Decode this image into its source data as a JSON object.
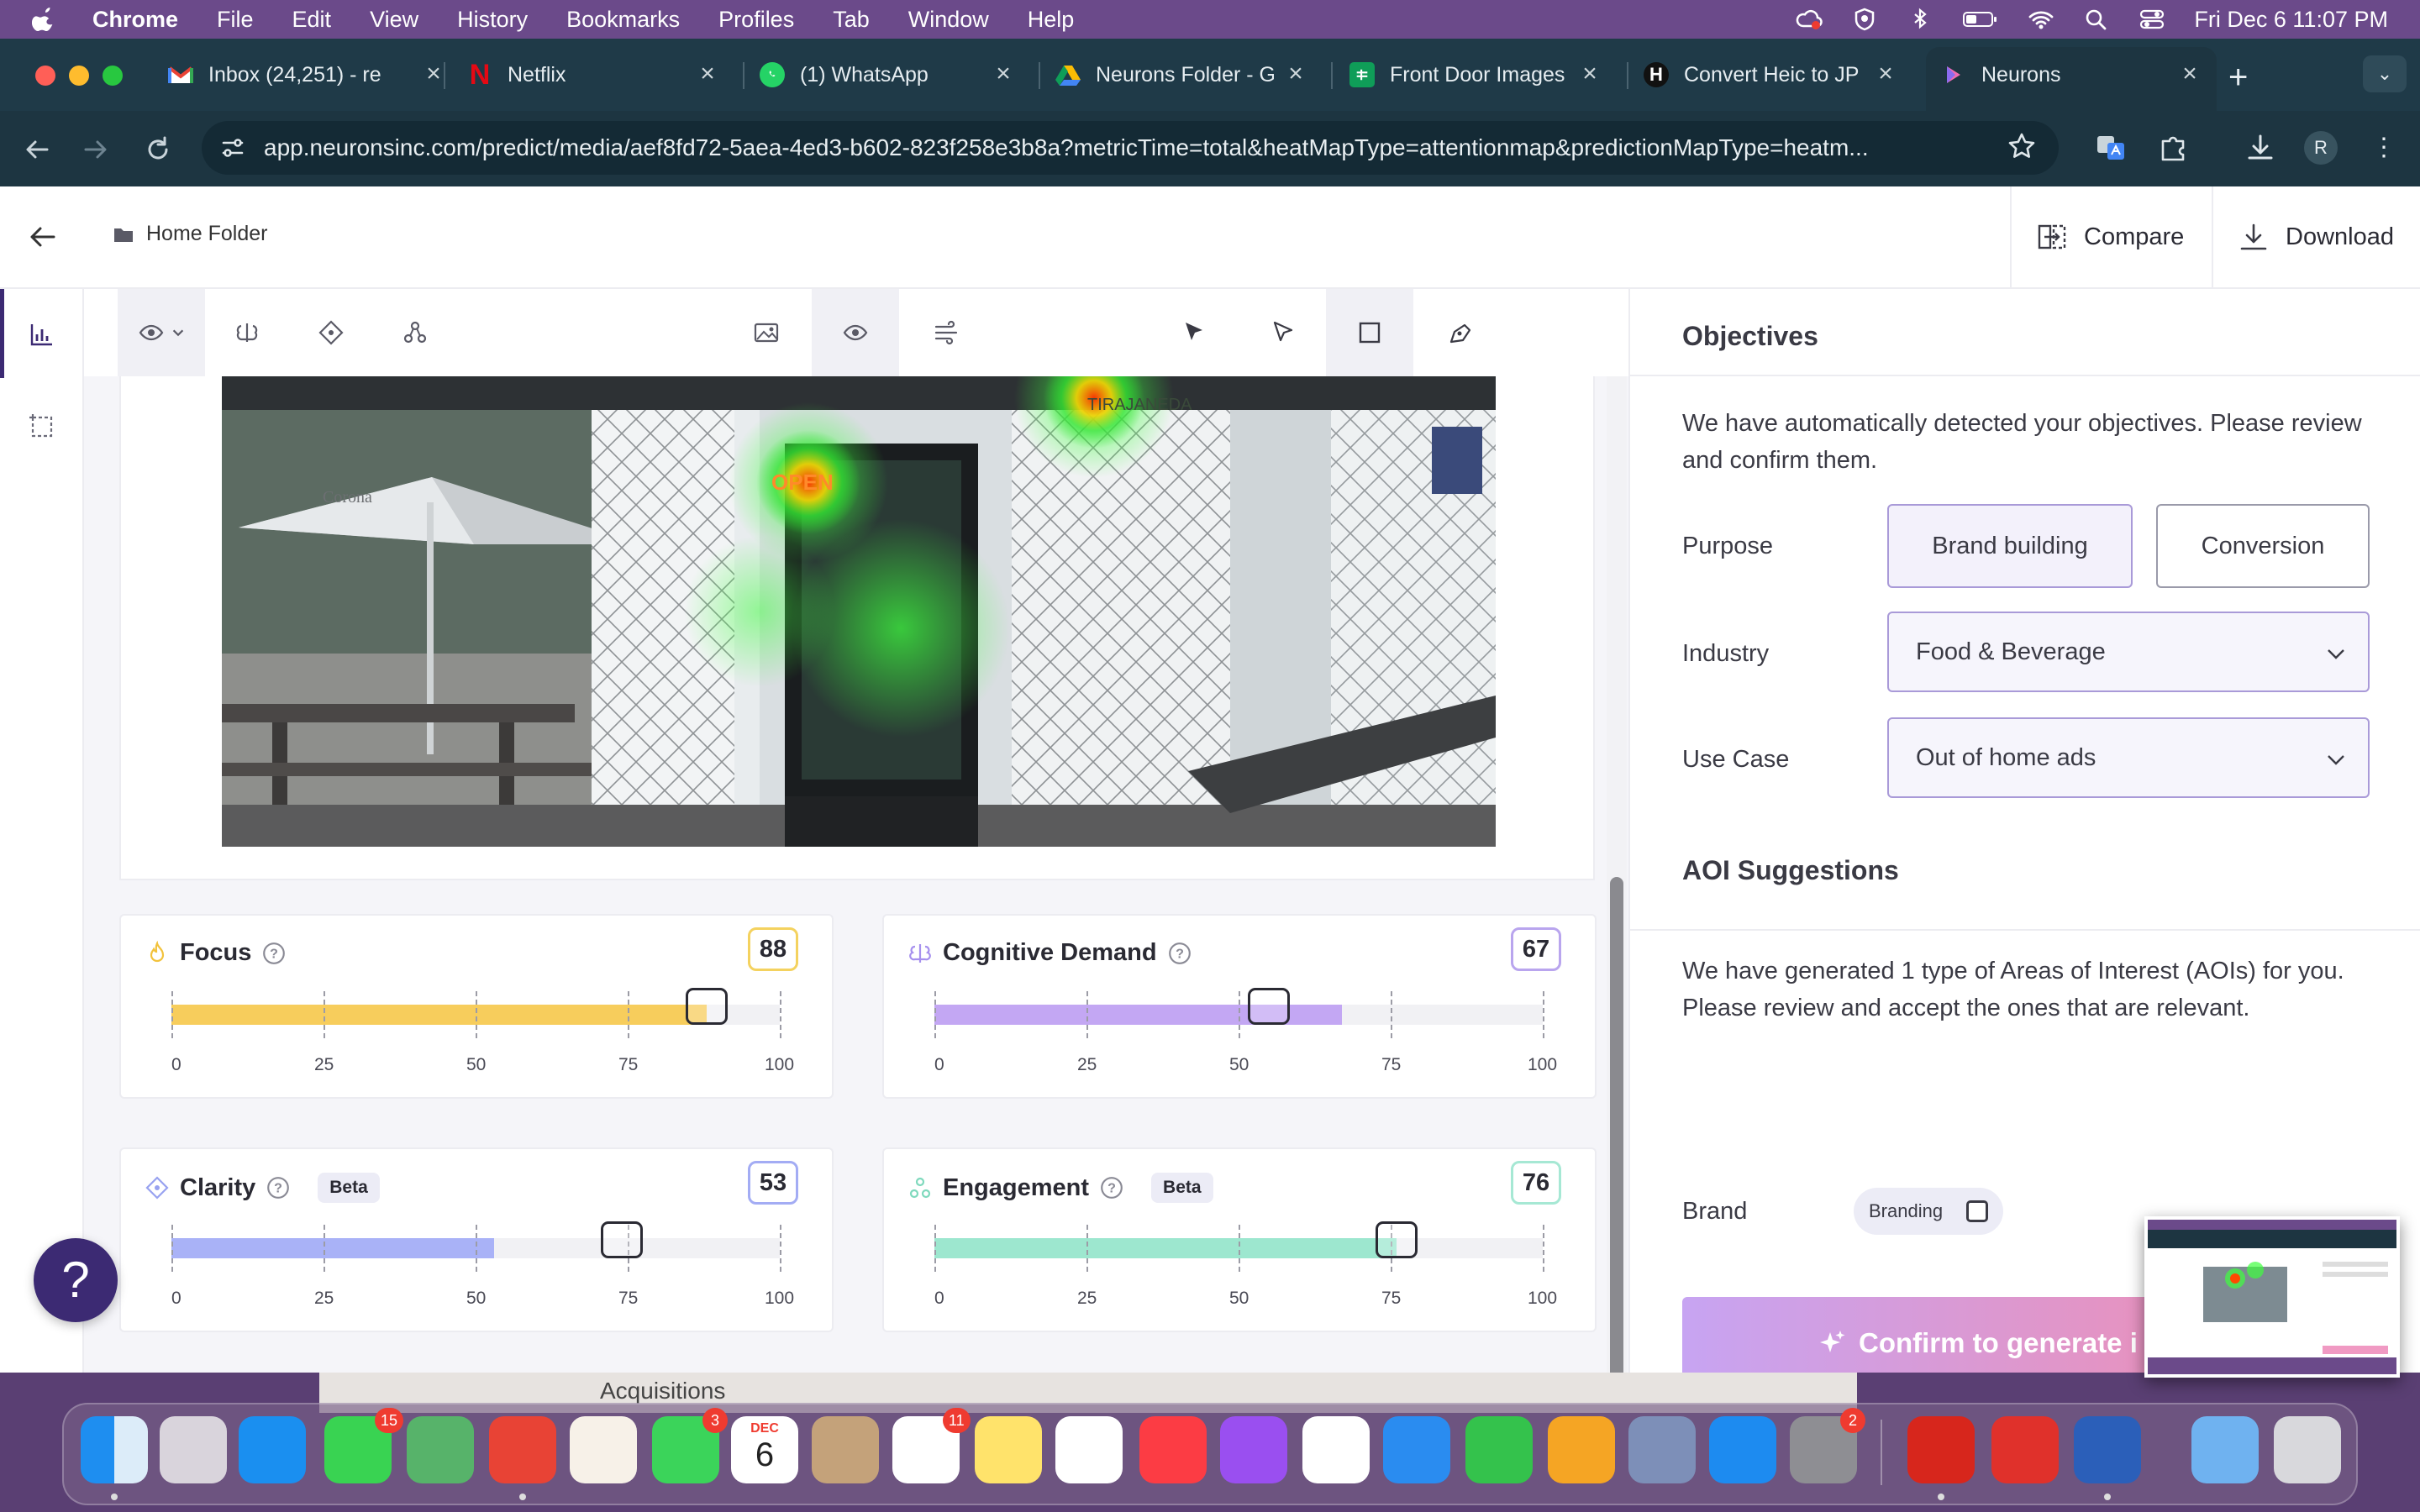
{
  "menubar": {
    "app": "Chrome",
    "items": [
      "File",
      "Edit",
      "View",
      "History",
      "Bookmarks",
      "Profiles",
      "Tab",
      "Window",
      "Help"
    ],
    "clock": "Fri Dec 6  11:07 PM"
  },
  "tabs": [
    {
      "title": "Inbox (24,251) - re",
      "icon": "gmail-icon"
    },
    {
      "title": "Netflix",
      "icon": "netflix-icon"
    },
    {
      "title": "(1) WhatsApp",
      "icon": "whatsapp-icon"
    },
    {
      "title": "Neurons Folder - G",
      "icon": "google-drive-icon"
    },
    {
      "title": "Front Door Images",
      "icon": "google-sheets-icon"
    },
    {
      "title": "Convert Heic to JP",
      "icon": "h-icon"
    },
    {
      "title": "Neurons",
      "icon": "neurons-icon",
      "active": true
    }
  ],
  "address_bar": {
    "url": "app.neuronsinc.com/predict/media/aef8fd72-5aea-4ed3-b602-823f258e3b8a?metricTime=total&heatMapType=attentionmap&predictionMapType=heatm..."
  },
  "profile_initial": "R",
  "app_header": {
    "breadcrumb": "Home Folder",
    "compare_label": "Compare",
    "download_label": "Download"
  },
  "metrics": [
    {
      "name": "Focus",
      "score": "88",
      "value": 88,
      "handle": 88,
      "color": "#f7cd5c",
      "border": "#f4d25f",
      "beta": false
    },
    {
      "name": "Cognitive Demand",
      "score": "67",
      "value": 67,
      "handle": 55,
      "color": "#c3a7f3",
      "border": "#b9a5ee",
      "beta": false
    },
    {
      "name": "Clarity",
      "score": "53",
      "value": 53,
      "handle": 74,
      "color": "#a9b2f7",
      "border": "#a3acf4",
      "beta": true
    },
    {
      "name": "Engagement",
      "score": "76",
      "value": 76,
      "handle": 76,
      "color": "#9de7cf",
      "border": "#a6e8d4",
      "beta": true
    }
  ],
  "axis_ticks": [
    "0",
    "25",
    "50",
    "75",
    "100"
  ],
  "beta_label": "Beta",
  "objectives": {
    "title": "Objectives",
    "intro": "We have automatically detected your objectives. Please review and confirm them.",
    "purpose_label": "Purpose",
    "purpose_options": [
      "Brand building",
      "Conversion"
    ],
    "industry_label": "Industry",
    "industry_value": "Food & Beverage",
    "use_case_label": "Use Case",
    "use_case_value": "Out of home ads"
  },
  "aoi": {
    "title": "AOI Suggestions",
    "intro": "We have generated 1 type of Areas of Interest (AOIs) for you. Please review and accept the ones that are relevant.",
    "brand_label": "Brand",
    "chip_label": "Branding",
    "confirm_label": "Confirm to generate i"
  },
  "photo_signs": {
    "open": "OPEN",
    "corona": "Corona",
    "street": "TIRAJANEDA"
  },
  "background_window_text": "Acquisitions",
  "help_label": "?",
  "dock_badges": {
    "messages": "15",
    "facetime": "3",
    "reminders": "11",
    "settings": "2"
  },
  "calendar": {
    "month": "DEC",
    "day": "6"
  }
}
